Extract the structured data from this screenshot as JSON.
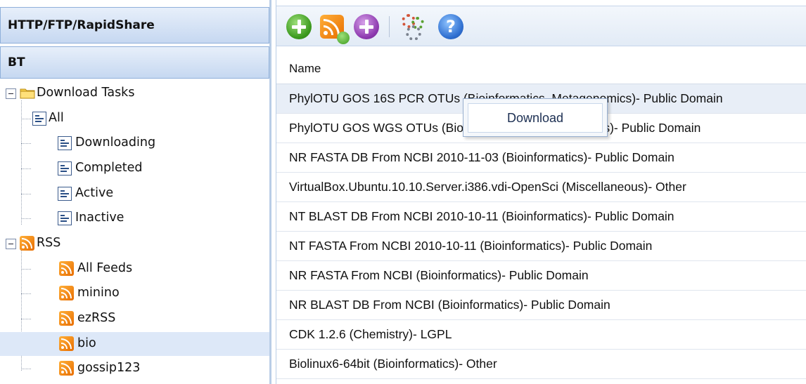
{
  "left_panel": {
    "http_header": "HTTP/FTP/RapidShare",
    "bt_header": "BT",
    "tree": {
      "download_tasks": {
        "label": "Download Tasks",
        "children": [
          "All",
          "Downloading",
          "Completed",
          "Active",
          "Inactive"
        ]
      },
      "rss": {
        "label": "RSS",
        "children": [
          "All Feeds",
          "minino",
          "ezRSS",
          "bio",
          "gossip123"
        ]
      },
      "selected": "bio"
    }
  },
  "toolbar": {
    "buttons": [
      "add-task",
      "add-rss-feed",
      "add",
      "settings",
      "help"
    ],
    "help_glyph": "?"
  },
  "grid": {
    "column_header": "Name",
    "rows": [
      "PhylOTU GOS 16S PCR OTUs (Bioinformatics, Metagenomics)- Public Domain",
      "PhylOTU GOS WGS OTUs (Bioinformatics, Metagenomics)- Public Domain",
      "NR FASTA DB From NCBI 2010-11-03 (Bioinformatics)- Public Domain",
      "VirtualBox.Ubuntu.10.10.Server.i386.vdi-OpenSci (Miscellaneous)- Other",
      "NT BLAST DB From NCBI 2010-10-11 (Bioinformatics)- Public Domain",
      "NT FASTA From NCBI 2010-10-11 (Bioinformatics)- Public Domain",
      "NR FASTA From NCBI (Bioinformatics)- Public Domain",
      "NR BLAST DB From NCBI (Bioinformatics)- Public Domain",
      "CDK 1.2.6 (Chemistry)- LGPL",
      "Biolinux6-64bit (Bioinformatics)- Other"
    ]
  },
  "context_menu": {
    "items": [
      "Download"
    ]
  },
  "colors": {
    "header_gradient_top": "#e7effa",
    "header_gradient_bottom": "#c6d8f1",
    "selection": "#dde8f8",
    "row_highlight": "#e8eef7"
  }
}
